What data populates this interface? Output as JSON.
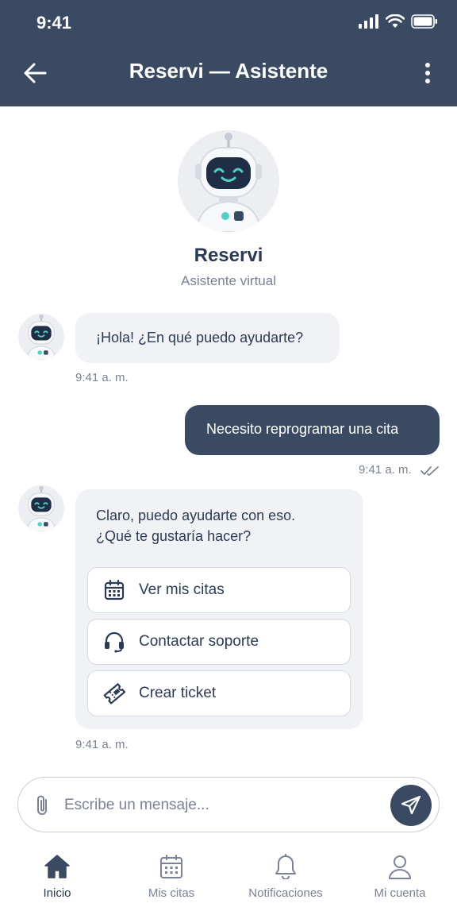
{
  "status_bar": {
    "time": "9:41"
  },
  "header": {
    "title": "Reservi — Asistente"
  },
  "profile": {
    "name": "Reservi",
    "subtitle": "Asistente virtual"
  },
  "messages": [
    {
      "from": "bot",
      "text": "¡Hola! ¿En qué puedo ayudarte?",
      "time": "9:41 a. m."
    },
    {
      "from": "user",
      "text": "Necesito reprogramar una cita",
      "time": "9:41 a. m."
    },
    {
      "from": "bot",
      "lines": [
        "Claro, puedo ayudarte con eso.",
        "¿Qué te gustaría hacer?"
      ],
      "time": "9:41 a. m.",
      "options": [
        {
          "label": "Ver mis citas",
          "icon": "calendar-icon"
        },
        {
          "label": "Contactar soporte",
          "icon": "headset-icon"
        },
        {
          "label": "Crear ticket",
          "icon": "ticket-icon"
        }
      ]
    }
  ],
  "composer": {
    "placeholder": "Escribe un mensaje..."
  },
  "tabs": [
    {
      "label": "Inicio",
      "icon": "home-icon",
      "active": true
    },
    {
      "label": "Mis citas",
      "icon": "calendar-icon",
      "active": false
    },
    {
      "label": "Notificaciones",
      "icon": "bell-icon",
      "active": false
    },
    {
      "label": "Mi cuenta",
      "icon": "user-icon",
      "active": false
    }
  ],
  "colors": {
    "primary": "#3a4a62",
    "bubble_bot": "#f1f2f5",
    "muted_text": "#7a8294",
    "accent": "#4fd1c5"
  }
}
